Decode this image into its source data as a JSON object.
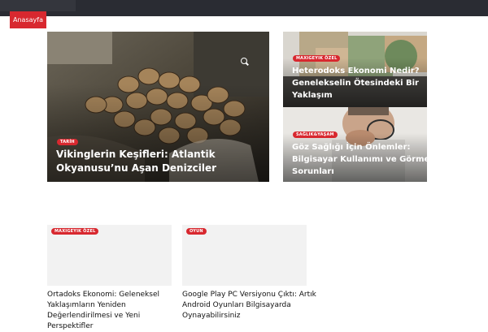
{
  "nav": {
    "home_label": "Anasayfa"
  },
  "featured": {
    "category": "TARİH",
    "title": "Vikinglerin Keşifleri: Atlantik Okyanusu’nu Aşan Denizciler"
  },
  "side_top": {
    "category": "MAXIGEYIK ÖZEL",
    "title": "Heterodoks Ekonomi Nedir? Genelekselin Ötesindeki Bir Yaklaşım"
  },
  "side_bottom": {
    "category": "SAĞLIK&YAŞAM",
    "title": "Göz Sağlığı İçin Önlemler: Bilgisayar Kullanımı ve Görme Sorunları"
  },
  "list": [
    {
      "category": "MAXIGEYIK ÖZEL",
      "title": "Ortadoks Ekonomi: Geleneksel Yaklaşımların Yeniden Değerlendirilmesi ve Yeni Perspektifler"
    },
    {
      "category": "OYUN",
      "title": "Google Play PC Versiyonu Çıktı: Artık Android Oyunları Bilgisayarda Oynayabilirsiniz"
    }
  ],
  "colors": {
    "accent": "#d8282f",
    "topbar": "#2a2c33"
  }
}
